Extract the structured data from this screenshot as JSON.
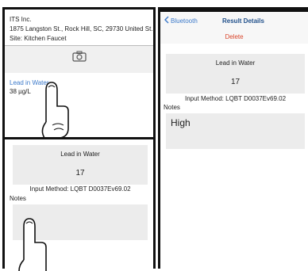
{
  "panel_1": {
    "company": "ITS Inc.",
    "address": "1875 Langston St., Rock Hill, SC, 29730 United St...",
    "site": "Site: Kitchen Faucet",
    "camera_icon": "camera-icon",
    "lead_label": "Lead in Water",
    "lead_value": "38 µg/L"
  },
  "panel_2": {
    "title": "Lead in Water",
    "value": "17",
    "method": "Input Method: LQBT   D0037Ev69.02",
    "notes_label": "Notes",
    "notes_text": ""
  },
  "panel_3": {
    "back_label": "Bluetooth",
    "nav_title": "Result Details",
    "delete_label": "Delete",
    "title": "Lead in Water",
    "value": "17",
    "method": "Input Method: LQBT   D0037Ev69.02",
    "notes_label": "Notes",
    "notes_text": "High"
  },
  "colors": {
    "link_blue": "#3a78c9",
    "delete_red": "#d9462c",
    "panel_gray": "#ececec"
  }
}
